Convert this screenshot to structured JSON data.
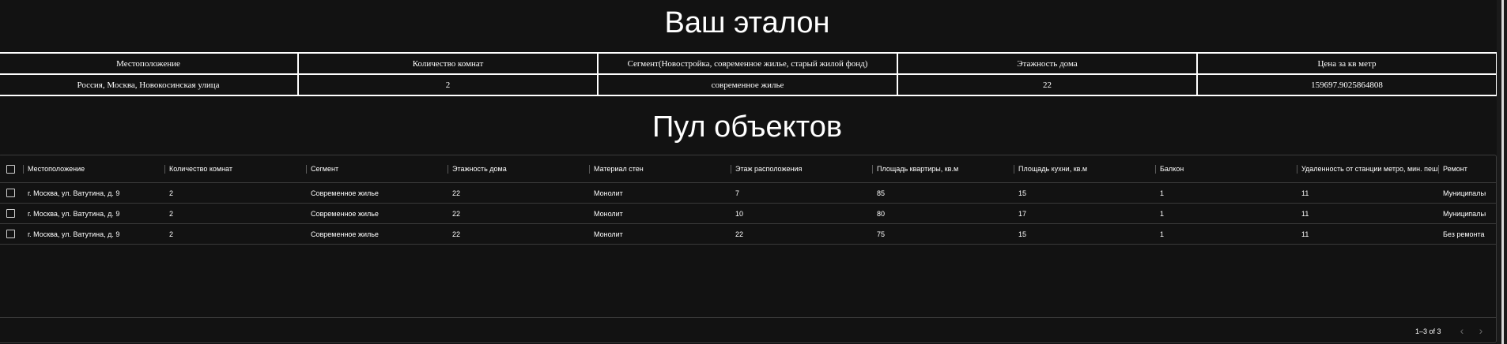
{
  "etalon": {
    "title": "Ваш эталон",
    "headers": [
      "Местоположение",
      "Количество комнат",
      "Сегмент(Новостройка, современное жилье, старый жилой фонд)",
      "Этажность дома",
      "Цена за кв метр"
    ],
    "row": [
      "Россия, Москва, Новокосинская улица",
      "2",
      "современное жилье",
      "22",
      "159697.9025864808"
    ]
  },
  "pool": {
    "title": "Пул объектов",
    "columns": [
      "Местоположение",
      "Количество комнат",
      "Сегмент",
      "Этажность дома",
      "Материал стен",
      "Этаж расположения",
      "Площадь квартиры, кв.м",
      "Площадь кухни, кв.м",
      "Балкон",
      "Удаленность от станции метро, мин. пешком",
      "Ремонт"
    ],
    "rows": [
      [
        "г. Москва, ул. Ватутина, д. 9",
        "2",
        "Современное жилье",
        "22",
        "Монолит",
        "7",
        "85",
        "15",
        "1",
        "11",
        "Муниципальный ремонт"
      ],
      [
        "г. Москва, ул. Ватутина, д. 9",
        "2",
        "Современное жилье",
        "22",
        "Монолит",
        "10",
        "80",
        "17",
        "1",
        "11",
        "Муниципальный ремонт"
      ],
      [
        "г. Москва, ул. Ватутина, д. 9",
        "2",
        "Современное жилье",
        "22",
        "Монолит",
        "22",
        "75",
        "15",
        "1",
        "11",
        "Без ремонта"
      ]
    ],
    "pagination": {
      "label": "1–3 of 3",
      "prev_icon": "chevron-left-icon",
      "next_icon": "chevron-right-icon"
    }
  },
  "colors": {
    "background": "#121212",
    "text": "#ffffff",
    "border": "#3a3a3a"
  }
}
